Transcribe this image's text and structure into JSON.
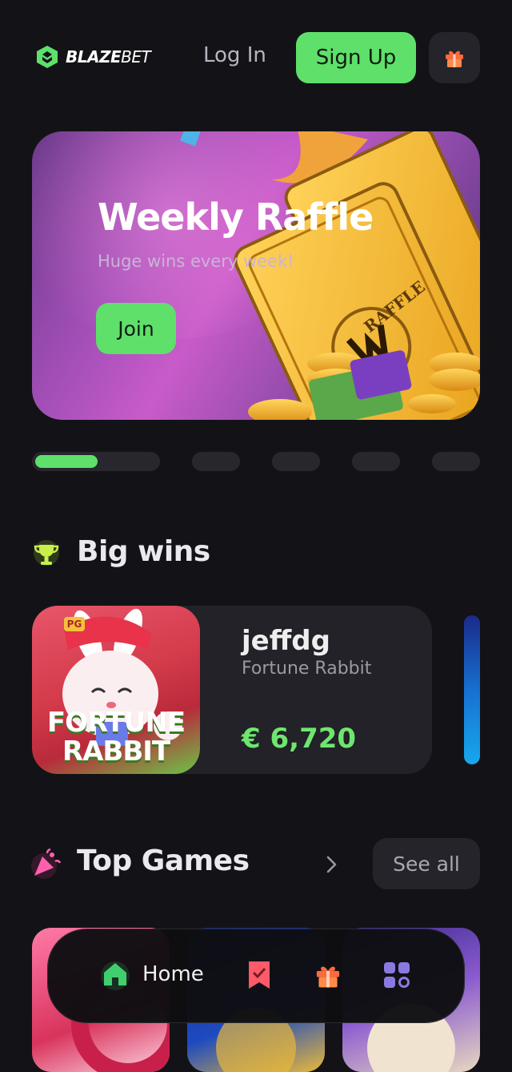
{
  "header": {
    "logo_primary": "BLAZE",
    "logo_secondary": "BET",
    "login_label": "Log In",
    "signup_label": "Sign Up",
    "gift_icon": "gift-icon"
  },
  "banner": {
    "title": "Weekly Raffle",
    "subtitle": "Huge wins every week!",
    "cta_label": "Join",
    "ticket_text": "RAFFLE",
    "slide_count": 5,
    "active_slide": 1
  },
  "big_wins": {
    "title": "Big wins",
    "icon": "trophy-icon",
    "items": [
      {
        "user": "jeffdg",
        "game": "Fortune Rabbit",
        "amount": "€ 6,720",
        "thumb_line1": "FORTUNE",
        "thumb_line2": "RABBIT",
        "thumb_badge": "PG"
      }
    ]
  },
  "top_games": {
    "title": "Top Games",
    "icon": "party-popper-icon",
    "see_all_label": "See all"
  },
  "bottom_nav": {
    "home_label": "Home",
    "items": [
      "home-icon",
      "bookmark-icon",
      "gift-icon",
      "grid-icon"
    ]
  },
  "colors": {
    "background": "#131317",
    "accent_green": "#5ee06a",
    "card": "#222228",
    "amount_green": "#6ee66e"
  }
}
